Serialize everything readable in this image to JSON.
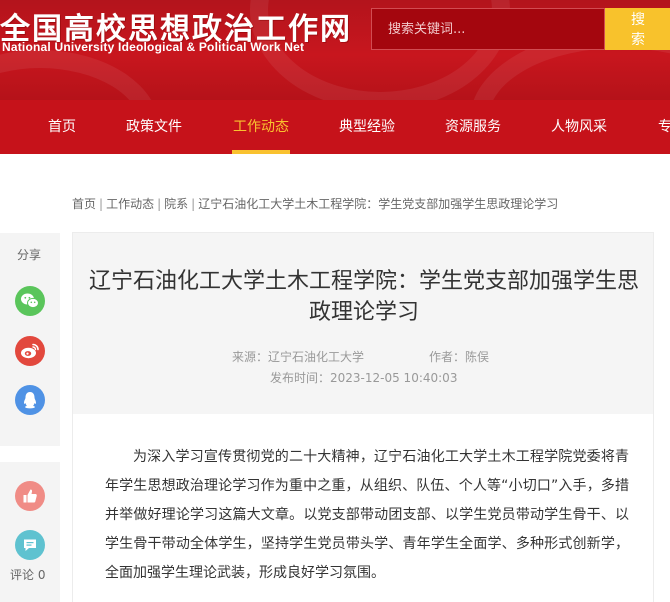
{
  "header": {
    "logo_cn": "全国高校思想政治工作网",
    "logo_en": "National University Ideological & Political Work Net",
    "search_placeholder": "搜索关键词...",
    "search_button": "搜 索"
  },
  "nav": {
    "items": [
      {
        "label": "首页"
      },
      {
        "label": "政策文件"
      },
      {
        "label": "工作动态"
      },
      {
        "label": "典型经验"
      },
      {
        "label": "资源服务"
      },
      {
        "label": "人物风采"
      },
      {
        "label": "专"
      }
    ],
    "active": "工作动态"
  },
  "breadcrumb": [
    "首页",
    "工作动态",
    "院系",
    "辽宁石油化工大学土木工程学院：学生党支部加强学生思政理论学习"
  ],
  "share": {
    "label": "分享",
    "icons": [
      "wechat-icon",
      "weibo-icon",
      "qq-icon"
    ]
  },
  "interact": {
    "comment_label": "评论 0",
    "icons": [
      "thumbs-up-icon",
      "comment-icon"
    ]
  },
  "article": {
    "title": "辽宁石油化工大学土木工程学院：学生党支部加强学生思政理论学习",
    "source": "来源：辽宁石油化工大学",
    "author": "作者：陈俣",
    "publish_time": "发布时间：2023-12-05 10:40:03",
    "paragraph": "为深入学习宣传贯彻党的二十大精神，辽宁石油化工大学土木工程学院党委将青年学生思想政治理论学习作为重中之重，从组织、队伍、个人等“小切口”入手，多措并举做好理论学习这篇大文章。以党支部带动团支部、以学生党员带动学生骨干、以学生骨干带动全体学生，坚持学生党员带头学、青年学生全面学、多种形式创新学，全面加强学生理论武装，形成良好学习氛围。"
  },
  "colors": {
    "header_red": "#c8161e",
    "nav_red": "#c6121a",
    "accent_gold": "#f9c22f",
    "wechat_green": "#5ac55b",
    "weibo_red": "#e2483d",
    "qq_blue": "#4f92e5",
    "like_pink": "#f08c86",
    "comment_teal": "#5fc2d0"
  }
}
